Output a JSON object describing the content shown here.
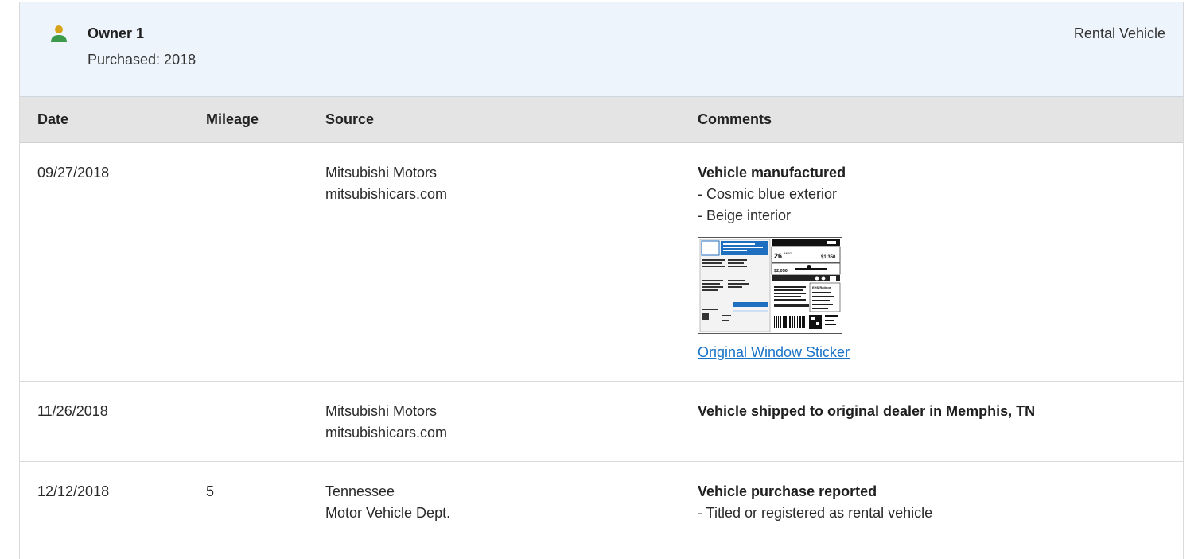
{
  "owner": {
    "name": "Owner 1",
    "purchased": "Purchased: 2018",
    "type": "Rental Vehicle",
    "icon": "person-icon",
    "icon_colors": {
      "head": "#d9a21b",
      "body": "#3c9a4a"
    }
  },
  "table": {
    "headers": [
      "Date",
      "Mileage",
      "Source",
      "Comments"
    ],
    "rows": [
      {
        "date": "09/27/2018",
        "mileage": "",
        "source_line1": "Mitsubishi Motors",
        "source_line2": "mitsubishicars.com",
        "comment_title": "Vehicle manufactured",
        "comment_items": [
          "- Cosmic blue exterior",
          "- Beige interior"
        ],
        "sticker_text": {
          "mpg_value": "26",
          "mpg_unit": "MPG",
          "fuel_cost": "$1,350",
          "save_value": "$2,050",
          "ratings_label": "EHS Ratings"
        },
        "link": "Original Window Sticker"
      },
      {
        "date": "11/26/2018",
        "mileage": "",
        "source_line1": "Mitsubishi Motors",
        "source_line2": "mitsubishicars.com",
        "comment_title": "Vehicle shipped to original dealer in Memphis, TN",
        "comment_items": []
      },
      {
        "date": "12/12/2018",
        "mileage": "5",
        "source_line1": "Tennessee",
        "source_line2": "Motor Vehicle Dept.",
        "comment_title": "Vehicle purchase reported",
        "comment_items": [
          "- Titled or registered as rental vehicle"
        ]
      }
    ]
  },
  "colors": {
    "header_bg": "#edf4fb",
    "table_header_bg": "#e4e4e4",
    "link": "#1a73c8",
    "sticker_blue": "#1f6fc0"
  }
}
